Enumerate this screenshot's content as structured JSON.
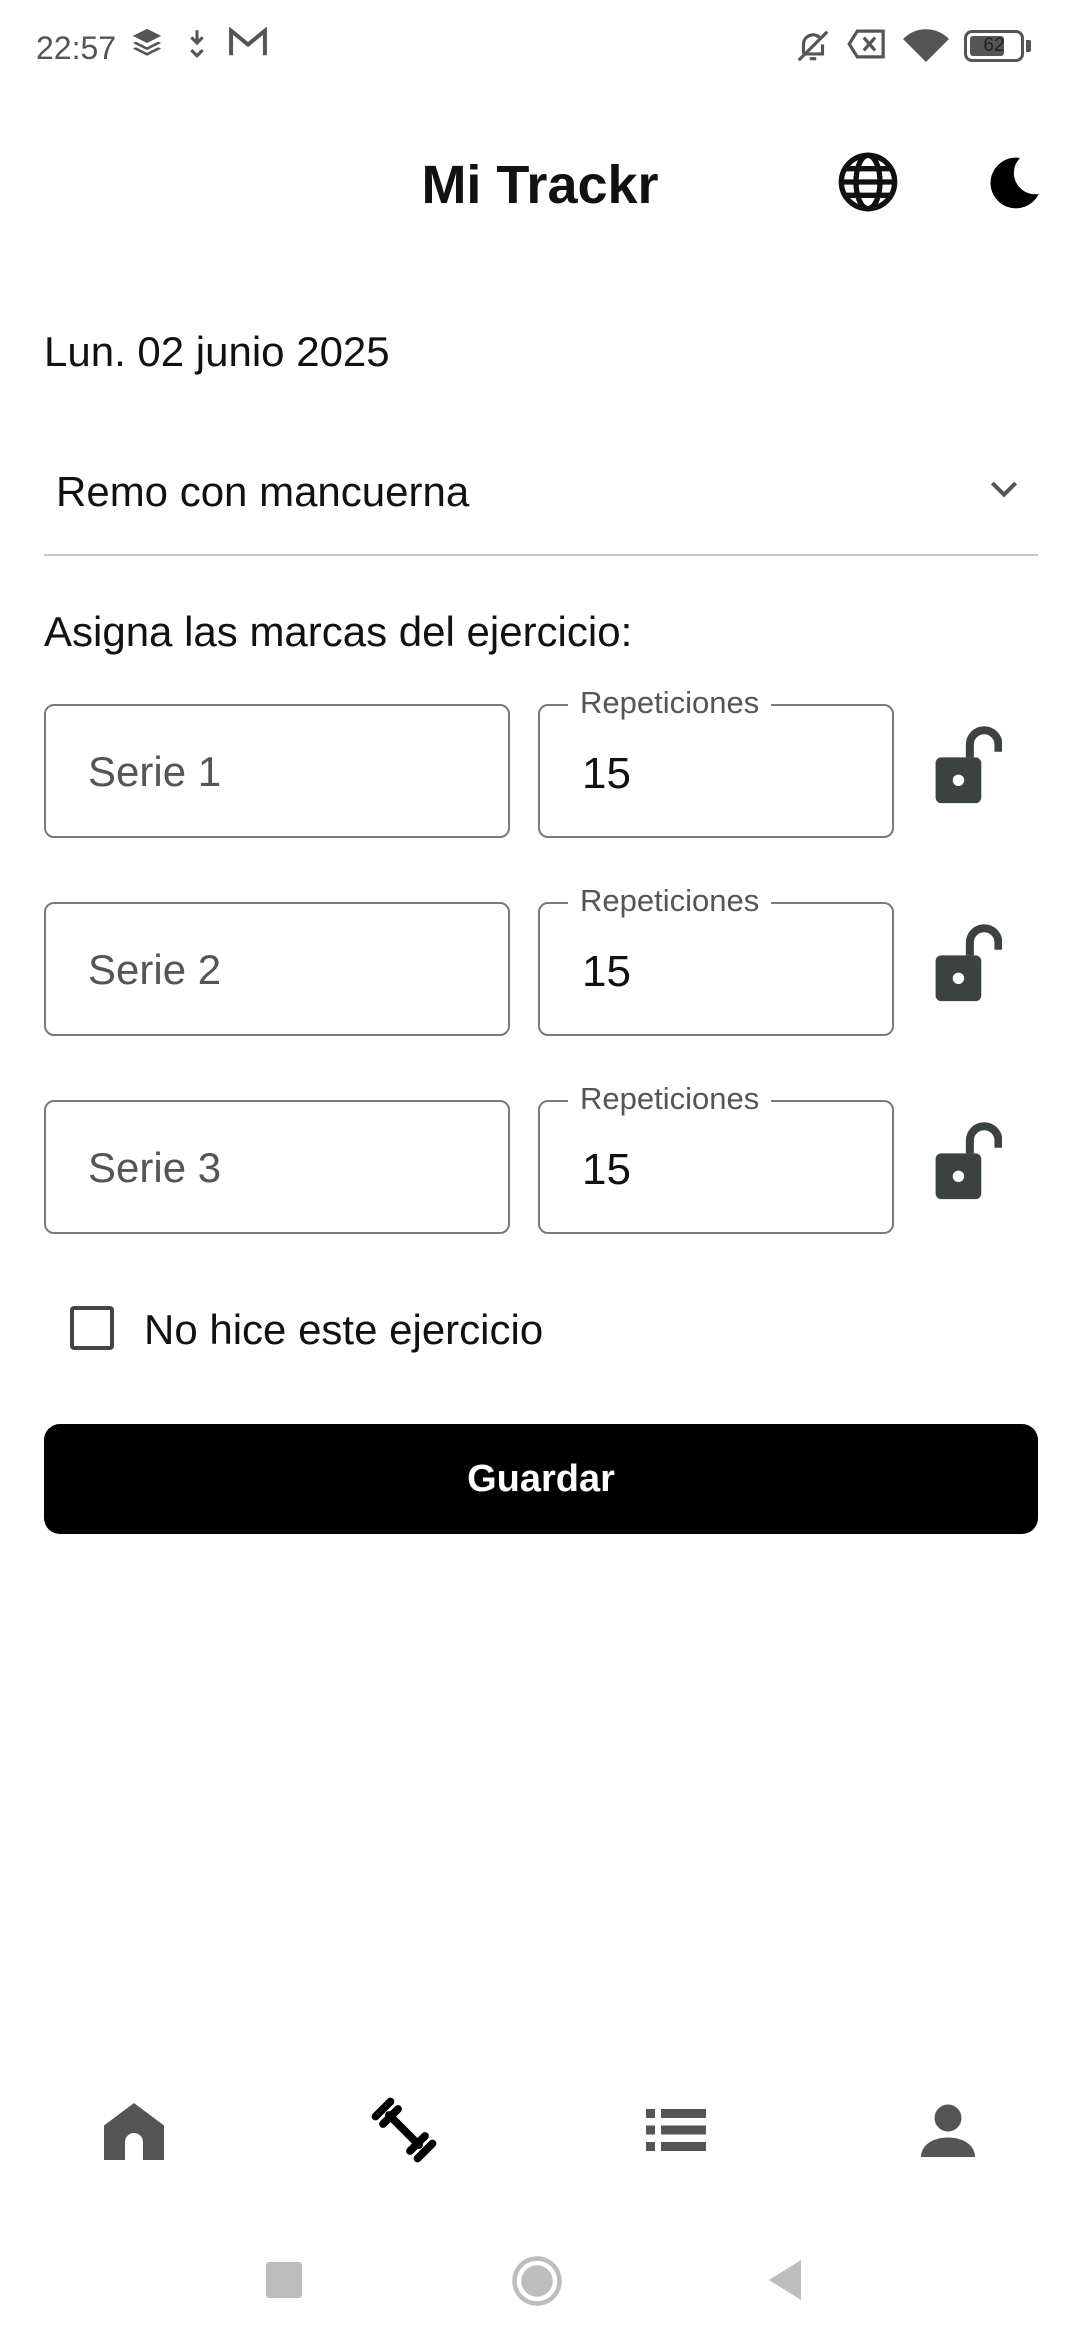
{
  "status_bar": {
    "time": "22:57",
    "battery": "62",
    "left_icons": [
      "layers-icon",
      "download-icon",
      "gmail-icon"
    ],
    "right_icons": [
      "bell-muted-icon",
      "data-off-icon",
      "wifi-icon",
      "battery-icon"
    ]
  },
  "header": {
    "title": "Mi Trackr",
    "icons": [
      "globe-icon",
      "moon-icon"
    ]
  },
  "date": "Lun. 02 junio 2025",
  "exercise_select": {
    "value": "Remo con mancuerna",
    "icon": "chevron-down-icon"
  },
  "instructions": "Asigna las marcas del ejercicio:",
  "series": [
    {
      "name": "Serie 1",
      "reps_label": "Repeticiones",
      "reps": "15",
      "lock_icon": "lock-open-icon"
    },
    {
      "name": "Serie 2",
      "reps_label": "Repeticiones",
      "reps": "15",
      "lock_icon": "lock-open-icon"
    },
    {
      "name": "Serie 3",
      "reps_label": "Repeticiones",
      "reps": "15",
      "lock_icon": "lock-open-icon"
    }
  ],
  "skip_checkbox": {
    "label": "No hice este ejercicio",
    "checked": false
  },
  "save_button": {
    "label": "Guardar"
  },
  "bottom_nav": {
    "items": [
      "home-icon",
      "dumbbell-icon",
      "list-icon",
      "person-icon"
    ],
    "active": "dumbbell-icon"
  },
  "colors": {
    "primary": "#000000",
    "icon_grey": "#555555",
    "lock": "#3c4240",
    "border": "#7a7a7a"
  }
}
